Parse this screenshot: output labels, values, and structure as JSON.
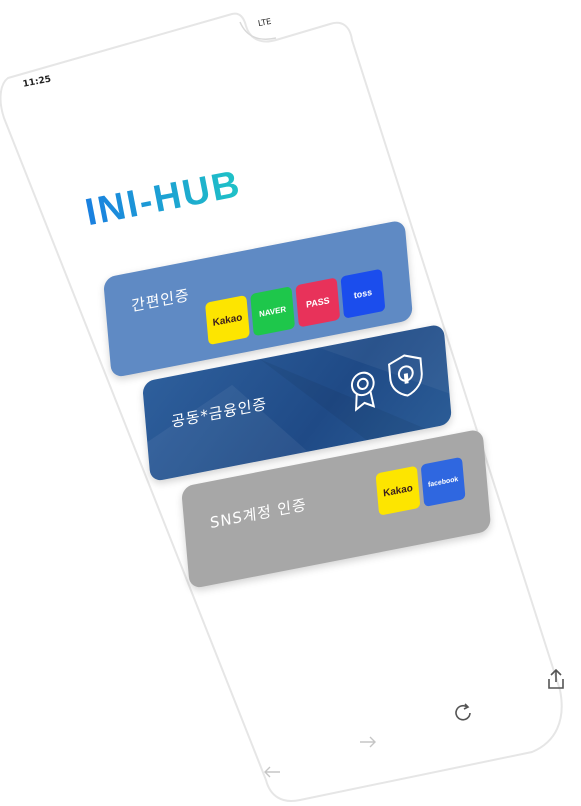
{
  "status_bar": {
    "time": "11:25",
    "network": "LTE"
  },
  "app": {
    "logo": "INI-HUB"
  },
  "cards": [
    {
      "label": "간편인증",
      "badges": [
        "Kakao",
        "NAVER",
        "PASS",
        "toss"
      ]
    },
    {
      "label": "공동*금융인증",
      "icons": [
        "certificate-medal-icon",
        "security-shield-icon"
      ]
    },
    {
      "label": "SNS계정 인증",
      "badges": [
        "Kakao",
        "facebook"
      ]
    }
  ],
  "toolbar": {
    "icons": [
      "share-icon",
      "refresh-icon",
      "forward-arrow-icon",
      "back-arrow-icon"
    ]
  },
  "colors": {
    "simple_auth_card": "#5f8ac4",
    "joint_auth_card": "#2e5f9c",
    "sns_card": "#a7a7a7",
    "kakao": "#fde500",
    "naver": "#1ec74b",
    "pass": "#e8325a",
    "toss": "#1b4ded",
    "facebook": "#2f67e0"
  }
}
